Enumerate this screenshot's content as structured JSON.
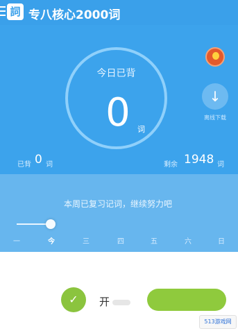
{
  "header": {
    "logo_glyph": "詞",
    "title": "专八核心2000词"
  },
  "today": {
    "label": "今日已背",
    "count": "0",
    "unit": "词"
  },
  "side": {
    "download_label": "离线下载"
  },
  "stats": {
    "learned_label": "已背",
    "learned_value": "0",
    "learned_unit": "词",
    "remaining_label": "剩余",
    "remaining_value": "1948",
    "remaining_unit": "词"
  },
  "week": {
    "note": "本周已复习记词，继续努力吧",
    "days": [
      "一",
      "今",
      "三",
      "四",
      "五",
      "六",
      "日"
    ],
    "active_day": "今"
  },
  "bottom": {
    "pill_text": "开"
  },
  "watermark": {
    "text": "513游戏网"
  },
  "colors": {
    "header_blue": "#3aa0ea",
    "panel_blue": "#3ca3ec",
    "ring_light_blue": "#8fd0fb",
    "bulb_orange": "#e45a2c",
    "green": "#8fca3d"
  }
}
